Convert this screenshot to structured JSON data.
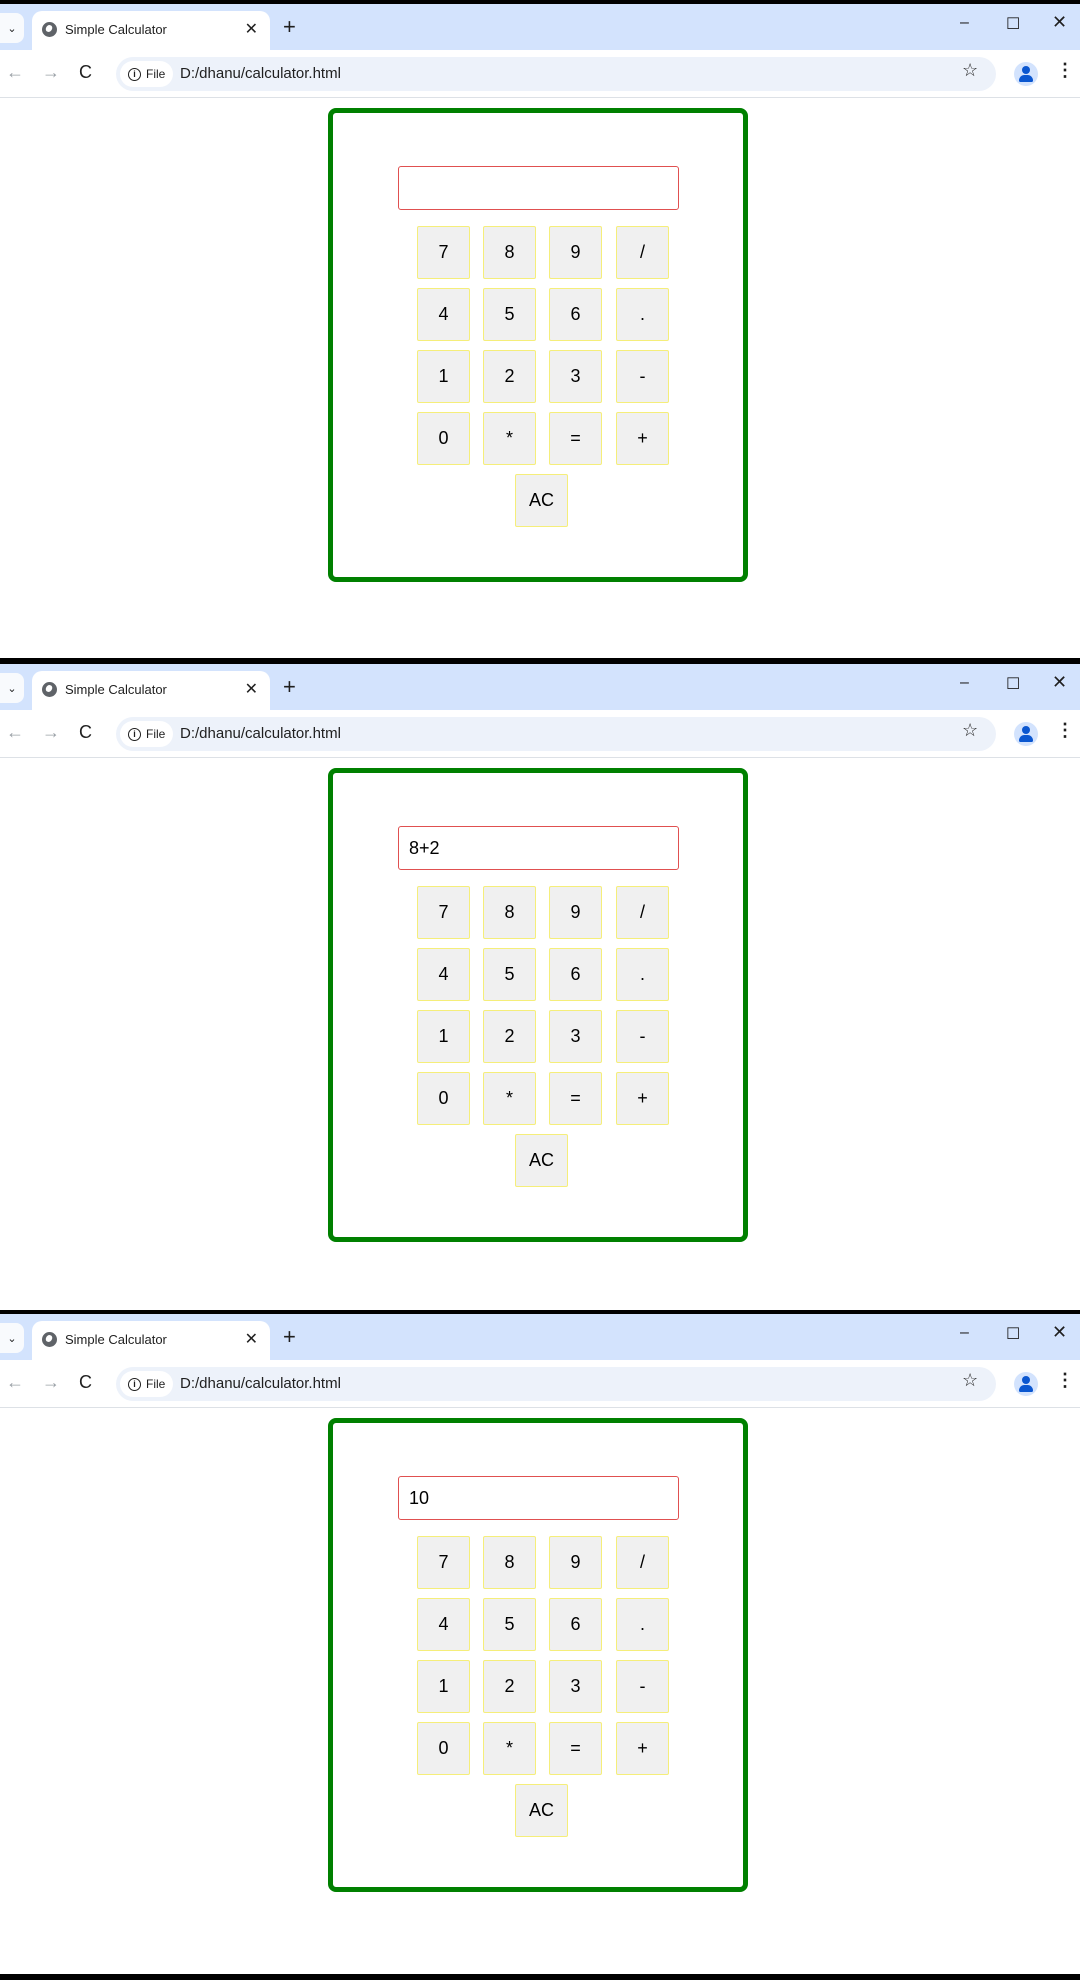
{
  "browser": {
    "tab_title": "Simple Calculator",
    "tab_close": "✕",
    "new_tab": "+",
    "window_controls": {
      "minimize": "–",
      "maximize": "☐",
      "close": "✕"
    },
    "nav": {
      "back": "←",
      "forward": "→",
      "reload": "C"
    },
    "site_chip": {
      "info": "i",
      "label": "File"
    },
    "url": "D:/dhanu/calculator.html",
    "bookmark_star": "☆",
    "menu": "⋮",
    "tab_menu": "⌄"
  },
  "calculator": {
    "keys": [
      "7",
      "8",
      "9",
      "/",
      "4",
      "5",
      "6",
      ".",
      "1",
      "2",
      "3",
      "-",
      "0",
      "*",
      "=",
      "+",
      "AC"
    ]
  },
  "screens": [
    {
      "display_value": ""
    },
    {
      "display_value": "8+2"
    },
    {
      "display_value": "10"
    }
  ],
  "colors": {
    "calculator_border": "#008000",
    "display_border": "#e05050",
    "key_border": "#f5ee7a",
    "key_background": "#f0f0f0"
  }
}
